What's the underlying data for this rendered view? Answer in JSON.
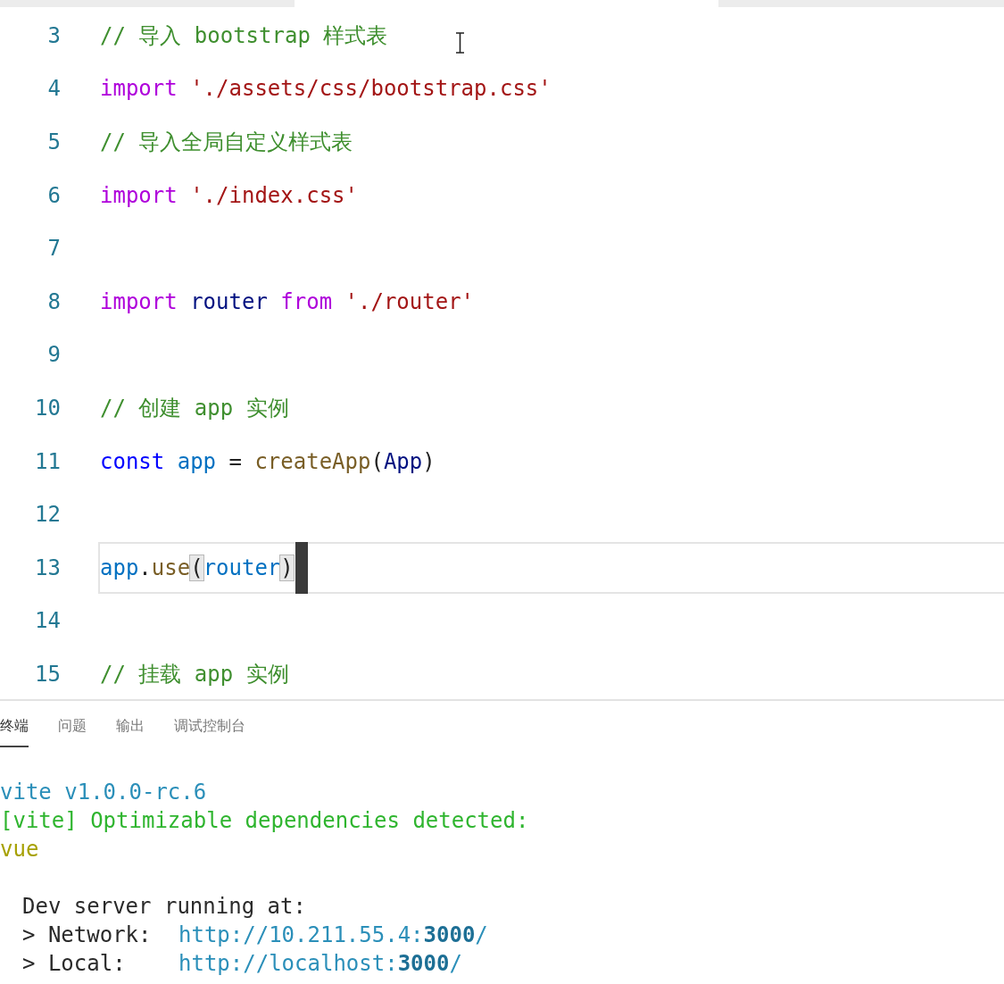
{
  "editor": {
    "lines": [
      {
        "number": "3",
        "current": false,
        "tokens": [
          {
            "kind": "comment",
            "text": "// 导入 bootstrap 样式表"
          }
        ]
      },
      {
        "number": "4",
        "current": false,
        "tokens": [
          {
            "kind": "keyword",
            "text": "import"
          },
          {
            "kind": "string",
            "text": " './assets/css/bootstrap.css'"
          }
        ]
      },
      {
        "number": "5",
        "current": false,
        "tokens": [
          {
            "kind": "comment",
            "text": "// 导入全局自定义样式表"
          }
        ]
      },
      {
        "number": "6",
        "current": false,
        "tokens": [
          {
            "kind": "keyword",
            "text": "import"
          },
          {
            "kind": "string",
            "text": " './index.css'"
          }
        ]
      },
      {
        "number": "7",
        "current": false
      },
      {
        "number": "8",
        "current": false,
        "tokens": [
          {
            "kind": "keyword",
            "text": "import"
          },
          {
            "kind": "variable",
            "text": " router"
          },
          {
            "kind": "keyword",
            "text": " from"
          },
          {
            "kind": "string",
            "text": " './router'"
          }
        ]
      },
      {
        "number": "9",
        "current": false
      },
      {
        "number": "10",
        "current": false,
        "tokens": [
          {
            "kind": "comment",
            "text": "// 创建 app 实例"
          }
        ]
      },
      {
        "number": "11",
        "current": false,
        "tokens": [
          {
            "kind": "storage",
            "text": "const"
          },
          {
            "kind": "constant",
            "text": " app"
          },
          {
            "kind": "plain",
            "text": " = "
          },
          {
            "kind": "function",
            "text": "createApp"
          },
          {
            "kind": "plain",
            "text": "("
          },
          {
            "kind": "variable",
            "text": "App"
          },
          {
            "kind": "plain",
            "text": ")"
          }
        ]
      },
      {
        "number": "12",
        "current": false
      },
      {
        "number": "13",
        "current": true,
        "tokens": [
          {
            "kind": "constant",
            "text": "app"
          },
          {
            "kind": "plain",
            "text": "."
          },
          {
            "kind": "function",
            "text": "use"
          },
          {
            "kind": "bracket",
            "text": "("
          },
          {
            "kind": "constant",
            "text": "router"
          },
          {
            "kind": "bracket",
            "text": ")"
          }
        ]
      },
      {
        "number": "14",
        "current": false
      },
      {
        "number": "15",
        "current": false,
        "tokens": [
          {
            "kind": "comment",
            "text": "// 挂载 app 实例"
          }
        ]
      }
    ]
  },
  "panel": {
    "tabs": [
      {
        "label": "终端",
        "selected": true
      },
      {
        "label": "问题",
        "selected": false
      },
      {
        "label": "输出",
        "selected": false
      },
      {
        "label": "调试控制台",
        "selected": false
      }
    ],
    "lines": [
      {
        "kind": "info",
        "text": "vite v1.0.0-rc.6"
      },
      {
        "kind": "success",
        "text": "[vite] Optimizable dependencies detected:"
      },
      {
        "kind": "dependency",
        "text": "vue"
      }
    ],
    "server": {
      "heading": "Dev server running at:",
      "links": [
        {
          "label": "> Network:",
          "url": "http://10.211.55.4:**3000**/"
        },
        {
          "label": "> Local:",
          "url": "http://localhost:**3000**/"
        }
      ]
    }
  }
}
